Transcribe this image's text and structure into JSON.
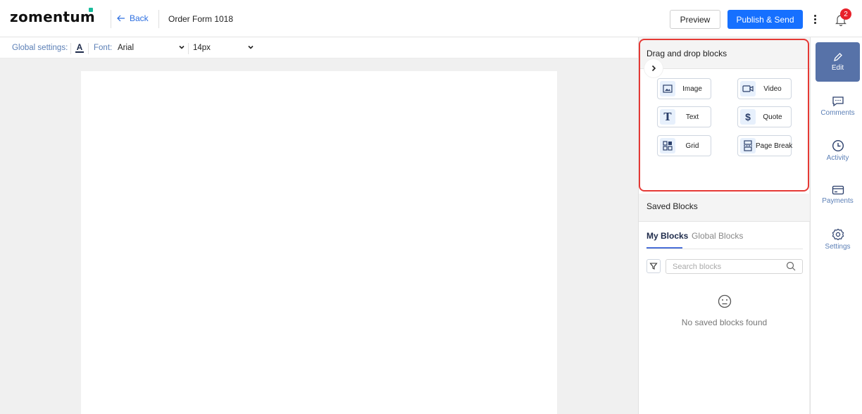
{
  "header": {
    "logo": "zomentum",
    "back_label": "Back",
    "doc_title": "Order Form 1018",
    "preview_label": "Preview",
    "publish_label": "Publish & Send",
    "notification_count": "2"
  },
  "global_settings": {
    "label": "Global settings:",
    "font_label": "Font:",
    "font_value": "Arial",
    "size_value": "14px"
  },
  "dnd": {
    "title": "Drag and drop blocks",
    "blocks": [
      {
        "label": "Image",
        "icon": "image-icon"
      },
      {
        "label": "Video",
        "icon": "video-icon"
      },
      {
        "label": "Text",
        "icon": "text-icon"
      },
      {
        "label": "Quote",
        "icon": "dollar-icon"
      },
      {
        "label": "Grid",
        "icon": "grid-icon"
      },
      {
        "label": "Page Break",
        "icon": "page-break-icon"
      }
    ]
  },
  "saved": {
    "title": "Saved Blocks",
    "tab_my": "My Blocks",
    "tab_global": "Global Blocks",
    "search_placeholder": "Search blocks",
    "empty_text": "No saved blocks found"
  },
  "rail": {
    "items": [
      {
        "label": "Edit",
        "icon": "pencil-icon",
        "active": true
      },
      {
        "label": "Comments",
        "icon": "comment-icon"
      },
      {
        "label": "Activity",
        "icon": "clock-icon"
      },
      {
        "label": "Payments",
        "icon": "card-icon"
      },
      {
        "label": "Settings",
        "icon": "gear-icon"
      }
    ]
  },
  "colors": {
    "primary": "#1670ff",
    "rail_active": "#5772a8",
    "highlight": "#e53935",
    "badge": "#e8212a"
  }
}
